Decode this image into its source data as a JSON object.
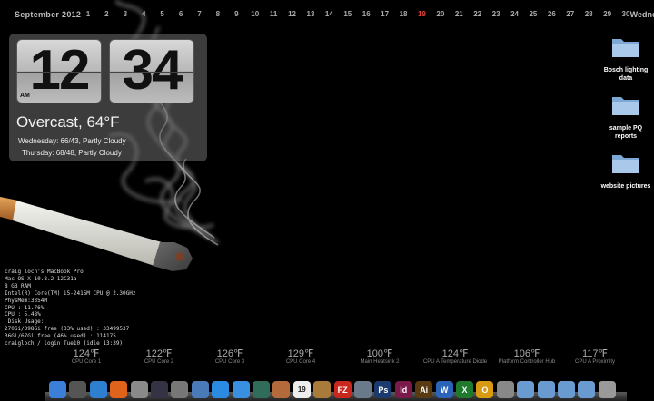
{
  "calendar": {
    "month": "September 2012",
    "days": [
      "1",
      "2",
      "3",
      "4",
      "5",
      "6",
      "7",
      "8",
      "9",
      "10",
      "11",
      "12",
      "13",
      "14",
      "15",
      "16",
      "17",
      "18",
      "19",
      "20",
      "21",
      "22",
      "23",
      "24",
      "25",
      "26",
      "27",
      "28",
      "29",
      "30"
    ],
    "today": "19",
    "today_color": "#e4413a",
    "weekday": "Wednes"
  },
  "clock": {
    "hour": "12",
    "minute": "34",
    "ampm": "AM"
  },
  "weather": {
    "current": "Overcast, 64°F",
    "forecast": [
      "Wednesday: 66/43, Partly Cloudy",
      "Thursday: 68/48, Partly Cloudy"
    ]
  },
  "folders": [
    {
      "label": "Bosch lighting data"
    },
    {
      "label": "sample PQ reports"
    },
    {
      "label": "website pictures"
    }
  ],
  "sysinfo": [
    "craig loch's MacBook Pro",
    "Mac OS X 10.8.2 12C31a",
    "8 GB RAM",
    "Intel(R) Core(TM) i5-2415M CPU @ 2.30GHz",
    "PhysMem:3354M",
    "CPU : 11.76%",
    "CPU : 5.48%",
    " Disk Usage:",
    "270Gi/398Gi free (33% used) : 33499537",
    "36Gi/67Gi free (46% used) : 114175",
    "craigloch / login Tue10 (idle 13:39)"
  ],
  "temps": [
    {
      "value": "124℉",
      "label": "CPU Core 1"
    },
    {
      "value": "122℉",
      "label": "CPU Core 2"
    },
    {
      "value": "126℉",
      "label": "CPU Core 3"
    },
    {
      "value": "129℉",
      "label": "CPU Core 4"
    },
    {
      "value": "100℉",
      "label": "Main Heatsink 2"
    },
    {
      "value": "124℉",
      "label": "CPU A Temperature Diode"
    },
    {
      "value": "106℉",
      "label": "Platform Controller Hub"
    },
    {
      "value": "117℉",
      "label": "CPU A Proximity"
    }
  ],
  "dock": [
    {
      "name": "finder-icon",
      "glyph": "",
      "color": "#3b7fd8"
    },
    {
      "name": "launchpad-icon",
      "glyph": "",
      "color": "#555"
    },
    {
      "name": "safari-icon",
      "glyph": "",
      "color": "#2e7fcf"
    },
    {
      "name": "firefox-icon",
      "glyph": "",
      "color": "#e0631c"
    },
    {
      "name": "mail-icon",
      "glyph": "",
      "color": "#8a8a8a"
    },
    {
      "name": "x11-icon",
      "glyph": "",
      "color": "#334"
    },
    {
      "name": "system-preferences-icon",
      "glyph": "",
      "color": "#777"
    },
    {
      "name": "network-icon",
      "glyph": "",
      "color": "#4a7ab8"
    },
    {
      "name": "app-store-icon",
      "glyph": "",
      "color": "#2a8be0"
    },
    {
      "name": "itunes-icon",
      "glyph": "",
      "color": "#3a90e0"
    },
    {
      "name": "time-machine-icon",
      "glyph": "",
      "color": "#2f6d5a"
    },
    {
      "name": "preview-icon",
      "glyph": "",
      "color": "#b46a3a"
    },
    {
      "name": "calendar-icon",
      "glyph": "19",
      "color": "#eeeeee"
    },
    {
      "name": "photos-icon",
      "glyph": "",
      "color": "#a87b3a"
    },
    {
      "name": "filezilla-icon",
      "glyph": "FZ",
      "color": "#c8281e"
    },
    {
      "name": "utility-icon",
      "glyph": "",
      "color": "#6a7a8a"
    },
    {
      "name": "photoshop-icon",
      "glyph": "Ps",
      "color": "#1b3a6e"
    },
    {
      "name": "indesign-icon",
      "glyph": "Id",
      "color": "#7a1a4a"
    },
    {
      "name": "illustrator-icon",
      "glyph": "Ai",
      "color": "#5a3a10"
    },
    {
      "name": "word-icon",
      "glyph": "W",
      "color": "#2a63b8"
    },
    {
      "name": "excel-icon",
      "glyph": "X",
      "color": "#1f7a2e"
    },
    {
      "name": "outlook-icon",
      "glyph": "O",
      "color": "#d79a10"
    },
    {
      "name": "documents-icon",
      "glyph": "",
      "color": "#888"
    },
    {
      "name": "folder-icon",
      "glyph": "",
      "color": "#6a9bd0"
    },
    {
      "name": "applications-folder-icon",
      "glyph": "",
      "color": "#6a9bd0"
    },
    {
      "name": "downloads-folder-icon",
      "glyph": "",
      "color": "#6a9bd0"
    },
    {
      "name": "stack-icon",
      "glyph": "",
      "color": "#6a9bd0"
    },
    {
      "name": "trash-icon",
      "glyph": "",
      "color": "#9a9a9a"
    }
  ]
}
